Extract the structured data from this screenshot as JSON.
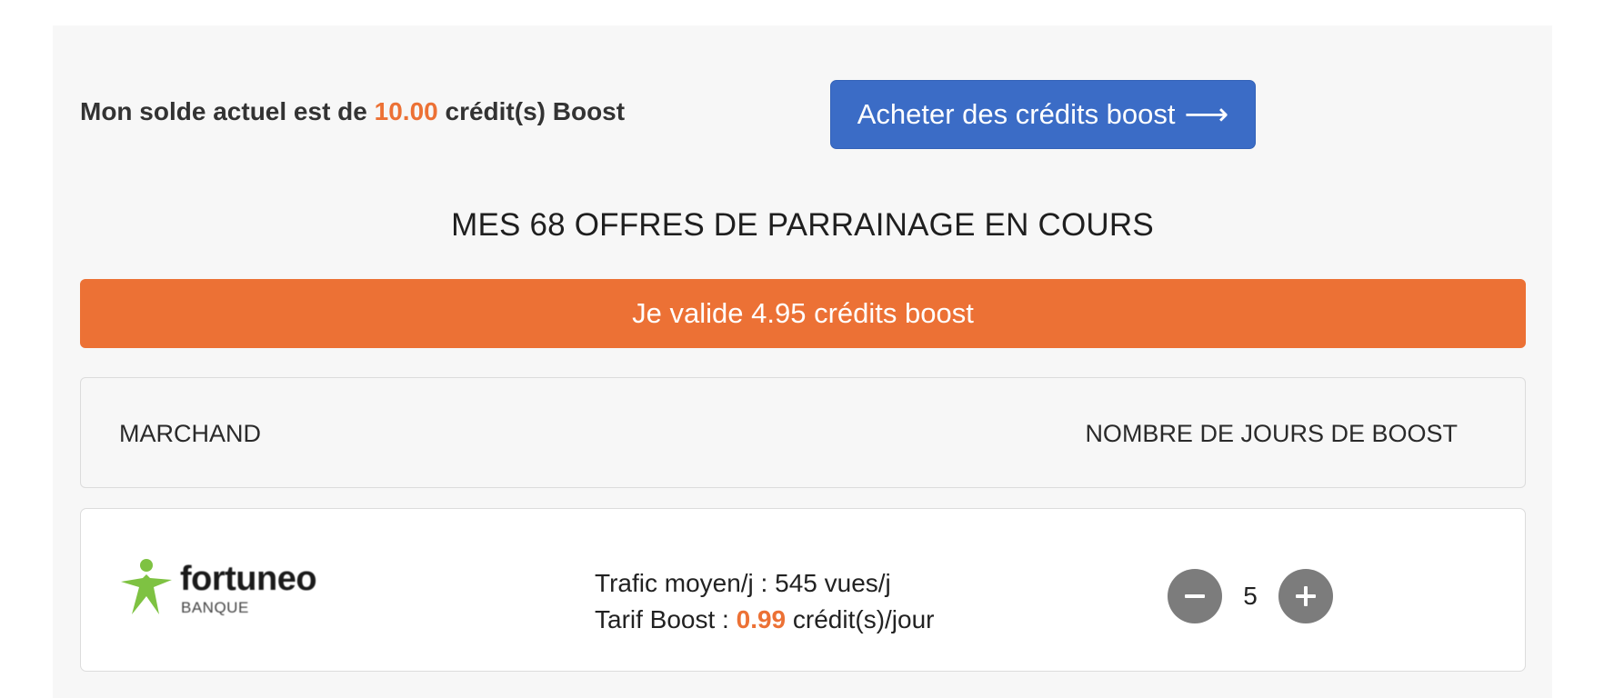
{
  "balance": {
    "prefix": "Mon solde actuel est de",
    "amount": "10.00",
    "suffix": "crédit(s) Boost"
  },
  "buy_button": {
    "label": "Acheter des crédits boost",
    "icon": "arrow-right-icon"
  },
  "section_title": "MES 68 OFFRES DE PARRAINAGE EN COURS",
  "validate_button": {
    "label": "Je valide 4.95 crédits boost"
  },
  "table": {
    "headers": {
      "merchant": "MARCHAND",
      "days": "NOMBRE DE JOURS DE BOOST"
    },
    "rows": [
      {
        "merchant_logo": {
          "name": "fortuneo",
          "subtitle": "BANQUE",
          "icon": "green-star-figure-icon"
        },
        "traffic_label": "Trafic moyen/j :",
        "traffic_value": "545 vues/j",
        "tariff_label": "Tarif Boost :",
        "tariff_value": "0.99",
        "tariff_unit": "crédit(s)/jour",
        "days": "5"
      }
    ]
  },
  "colors": {
    "accent_orange": "#ec7135",
    "primary_blue": "#3b6cc6",
    "stepper_gray": "#7c7c7c",
    "logo_green": "#7ec242"
  }
}
